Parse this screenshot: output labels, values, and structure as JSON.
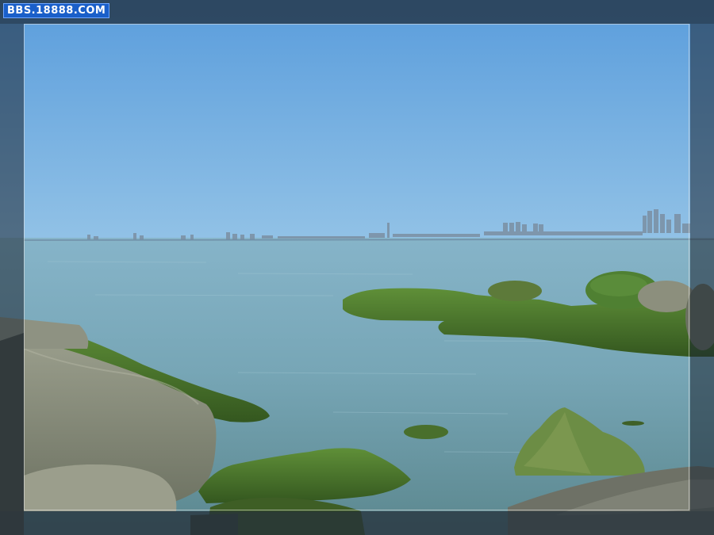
{
  "watermark": {
    "text": "BBS.18888.COM"
  },
  "colors": {
    "sky_top": "#5e9fdd",
    "sky_horizon": "#8fc0e6",
    "sea_far": "#7aa7bb",
    "sea_near": "#5f8a90",
    "moss": "#4b7a2e",
    "rock": "#8a8e7c",
    "outer_frame": "#2a3440"
  }
}
